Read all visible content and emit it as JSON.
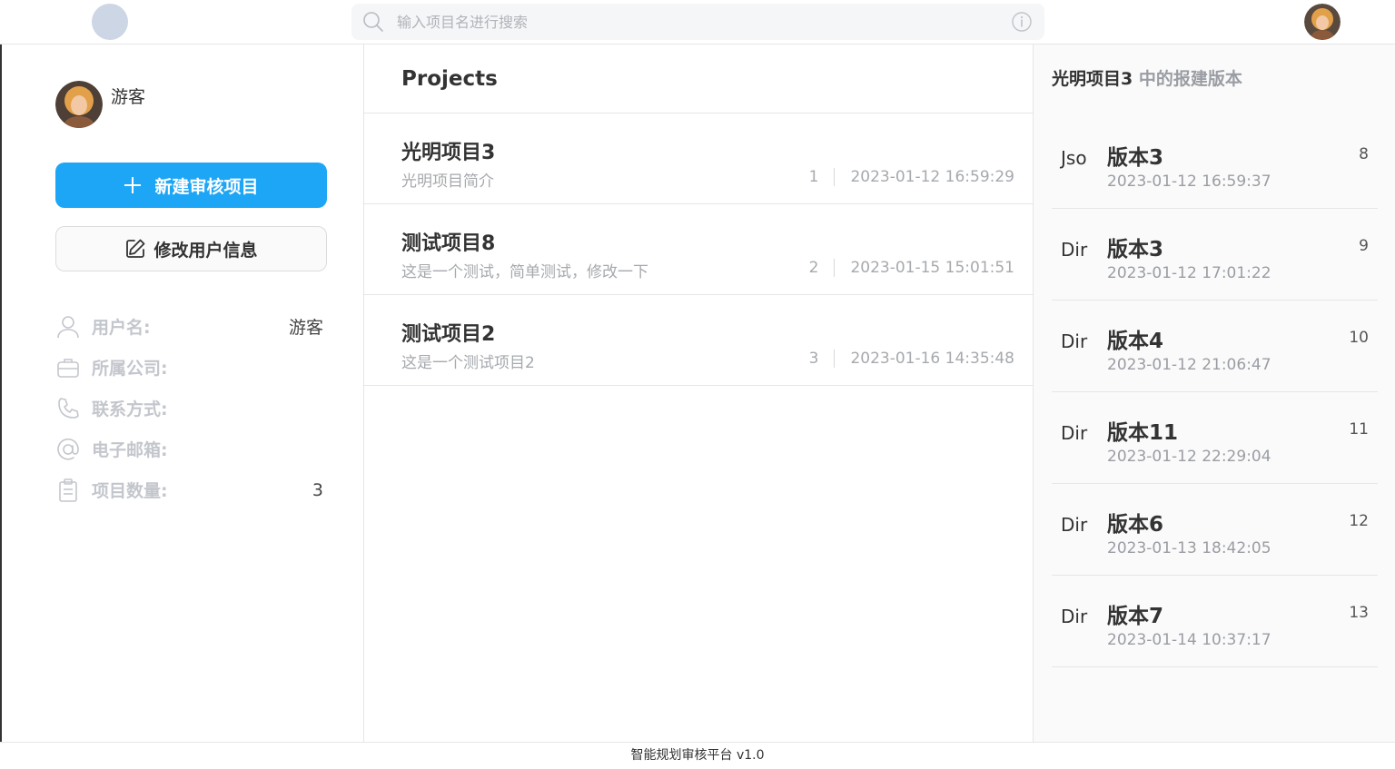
{
  "search": {
    "placeholder": "输入项目名进行搜索"
  },
  "user": {
    "name": "游客",
    "new_project_label": "新建审核项目",
    "edit_user_label": "修改用户信息",
    "fields": [
      {
        "icon": "user-icon",
        "label": "用户名:",
        "value": "游客"
      },
      {
        "icon": "briefcase-icon",
        "label": "所属公司:",
        "value": ""
      },
      {
        "icon": "phone-icon",
        "label": "联系方式:",
        "value": ""
      },
      {
        "icon": "at-sign-icon",
        "label": "电子邮箱:",
        "value": ""
      },
      {
        "icon": "clipboard-icon",
        "label": "项目数量:",
        "value": "3"
      }
    ]
  },
  "projects": {
    "title": "Projects",
    "items": [
      {
        "name": "光明项目3",
        "description": "光明项目简介",
        "id": "1",
        "date": "2023-01-12 16:59:29"
      },
      {
        "name": "测试项目8",
        "description": "这是一个测试，简单测试，修改一下",
        "id": "2",
        "date": "2023-01-15 15:01:51"
      },
      {
        "name": "测试项目2",
        "description": "这是一个测试项目2",
        "id": "3",
        "date": "2023-01-16 14:35:48"
      }
    ]
  },
  "versions": {
    "project_name": "光明项目3",
    "title_suffix": " 中的报建版本",
    "items": [
      {
        "type": "Jso",
        "name": "版本3",
        "time": "2023-01-12 16:59:37",
        "id": "8"
      },
      {
        "type": "Dir",
        "name": "版本3",
        "time": "2023-01-12 17:01:22",
        "id": "9"
      },
      {
        "type": "Dir",
        "name": "版本4",
        "time": "2023-01-12 21:06:47",
        "id": "10"
      },
      {
        "type": "Dir",
        "name": "版本11",
        "time": "2023-01-12 22:29:04",
        "id": "11"
      },
      {
        "type": "Dir",
        "name": "版本6",
        "time": "2023-01-13 18:42:05",
        "id": "12"
      },
      {
        "type": "Dir",
        "name": "版本7",
        "time": "2023-01-14 10:37:17",
        "id": "13"
      }
    ]
  },
  "footer": {
    "text": "智能规划审核平台 v1.0"
  },
  "colors": {
    "accent": "#1ea6f6",
    "muted": "#a6a9ad",
    "border": "#e6e6e6"
  }
}
